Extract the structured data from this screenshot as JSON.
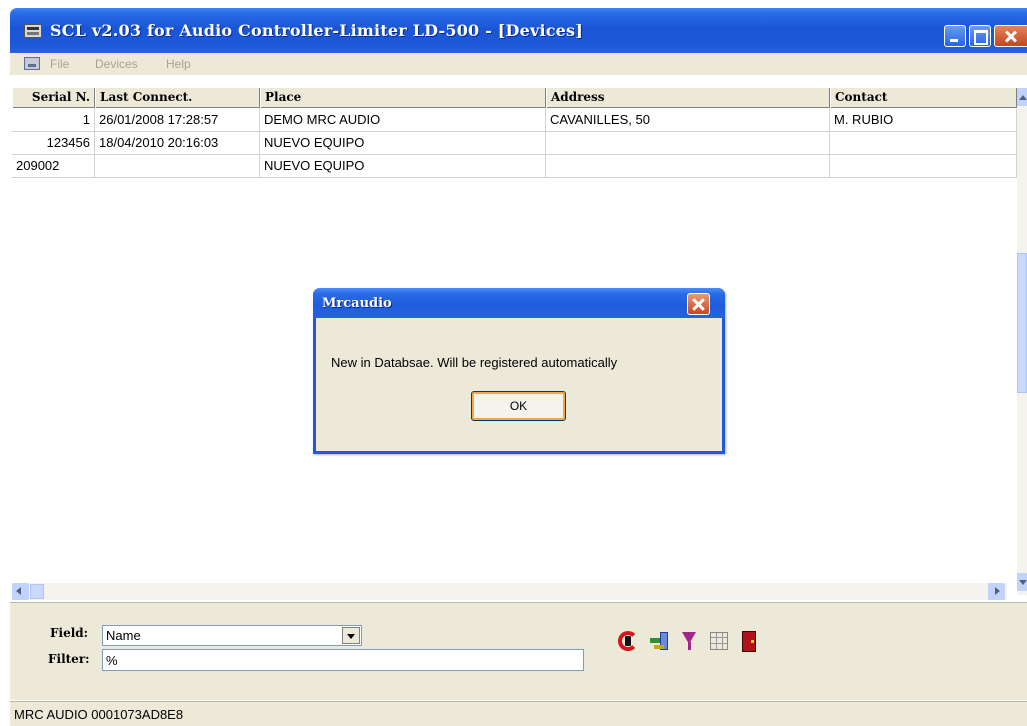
{
  "window": {
    "title": "SCL v2.03 for Audio Controller-Limiter LD-500 - [Devices]"
  },
  "menu": {
    "items": [
      "File",
      "Devices",
      "Help"
    ]
  },
  "table": {
    "columns": [
      "Serial N.",
      "Last Connect.",
      "Place",
      "Address",
      "Contact"
    ],
    "rows": [
      [
        "1",
        "26/01/2008 17:28:57",
        "DEMO MRC AUDIO",
        "CAVANILLES, 50",
        "M. RUBIO"
      ],
      [
        "123456",
        "18/04/2010 20:16:03",
        "NUEVO EQUIPO",
        "",
        ""
      ],
      [
        "209002",
        "",
        "NUEVO EQUIPO",
        "",
        ""
      ]
    ]
  },
  "filter_panel": {
    "field_label": "Field:",
    "field_value": "Name",
    "filter_label": "Filter:",
    "filter_value": "%"
  },
  "toolbar": {
    "icons": [
      "refresh-icon",
      "connect-device-icon",
      "filter-icon",
      "grid-icon",
      "exit-icon"
    ]
  },
  "status": {
    "text": "MRC AUDIO 0001073AD8E8"
  },
  "dialog": {
    "title": "Mrcaudio",
    "message": "New in Databsae. Will be registered automatically",
    "ok_label": "OK"
  },
  "colors": {
    "titlebar": "#1a55d6",
    "close_button": "#c7471f",
    "panel": "#ece9d8"
  }
}
